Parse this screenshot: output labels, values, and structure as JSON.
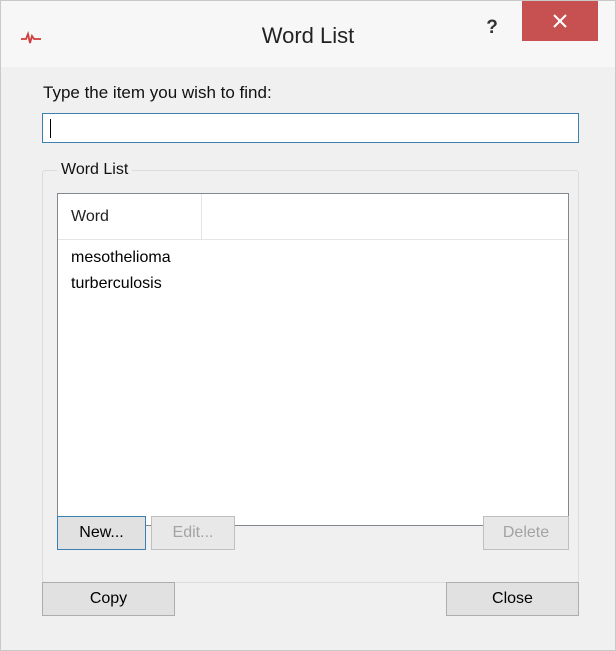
{
  "window": {
    "title": "Word List",
    "help_label": "?",
    "accent_close": "#c75050"
  },
  "find": {
    "prompt": "Type the item you wish to find:",
    "value": "",
    "placeholder": ""
  },
  "word_list": {
    "group_label": "Word List",
    "column_header": "Word",
    "items": [
      "mesothelioma",
      "turberculosis"
    ]
  },
  "buttons": {
    "new": "New...",
    "edit": "Edit...",
    "delete": "Delete",
    "copy": "Copy",
    "close": "Close"
  },
  "icons": {
    "app": "pulse-icon",
    "close": "close-x-icon"
  }
}
